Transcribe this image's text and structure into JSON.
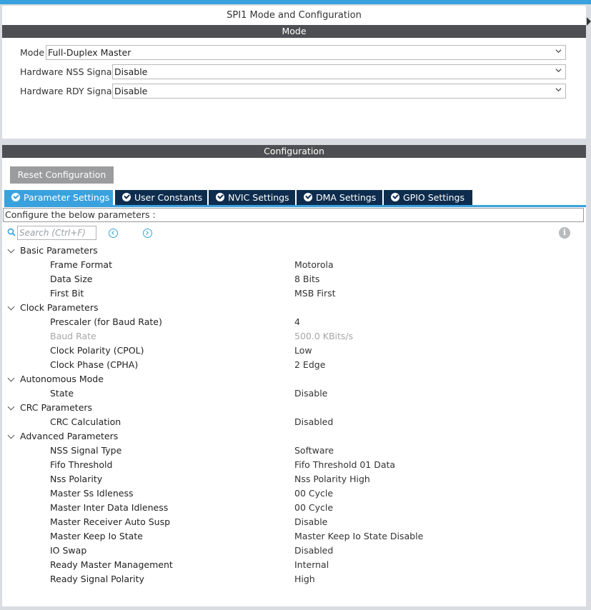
{
  "window": {
    "title": "SPI1 Mode and Configuration"
  },
  "mode_section": {
    "header": "Mode",
    "fields": [
      {
        "label": "Mode",
        "value": "Full-Duplex Master"
      },
      {
        "label": "Hardware NSS Signal",
        "value": "Disable"
      },
      {
        "label": "Hardware RDY Signal",
        "value": "Disable"
      }
    ]
  },
  "config_section": {
    "header": "Configuration",
    "reset_label": "Reset Configuration",
    "tabs": [
      {
        "label": "Parameter Settings",
        "active": true
      },
      {
        "label": "User Constants",
        "active": false
      },
      {
        "label": "NVIC Settings",
        "active": false
      },
      {
        "label": "DMA Settings",
        "active": false
      },
      {
        "label": "GPIO Settings",
        "active": false
      }
    ],
    "description": "Configure the below parameters :",
    "search": {
      "placeholder": "Search (Ctrl+F)"
    }
  },
  "params": {
    "groups": [
      {
        "name": "Basic Parameters",
        "items": [
          {
            "name": "Frame Format",
            "value": "Motorola"
          },
          {
            "name": "Data Size",
            "value": "8 Bits"
          },
          {
            "name": "First Bit",
            "value": "MSB First"
          }
        ]
      },
      {
        "name": "Clock Parameters",
        "items": [
          {
            "name": "Prescaler (for Baud Rate)",
            "value": "4"
          },
          {
            "name": "Baud Rate",
            "value": "500.0 KBits/s",
            "disabled": true
          },
          {
            "name": "Clock Polarity (CPOL)",
            "value": "Low"
          },
          {
            "name": "Clock Phase (CPHA)",
            "value": "2 Edge"
          }
        ]
      },
      {
        "name": "Autonomous Mode",
        "items": [
          {
            "name": "State",
            "value": "Disable"
          }
        ]
      },
      {
        "name": "CRC Parameters",
        "items": [
          {
            "name": "CRC Calculation",
            "value": "Disabled"
          }
        ]
      },
      {
        "name": "Advanced Parameters",
        "items": [
          {
            "name": "NSS Signal Type",
            "value": "Software"
          },
          {
            "name": "Fifo Threshold",
            "value": "Fifo Threshold 01 Data"
          },
          {
            "name": "Nss Polarity",
            "value": "Nss Polarity High"
          },
          {
            "name": "Master Ss Idleness",
            "value": "00 Cycle"
          },
          {
            "name": "Master Inter Data Idleness",
            "value": "00 Cycle"
          },
          {
            "name": "Master Receiver Auto Susp",
            "value": "Disable"
          },
          {
            "name": "Master Keep Io State",
            "value": "Master Keep Io State Disable"
          },
          {
            "name": "IO Swap",
            "value": "Disabled"
          },
          {
            "name": "Ready Master Management",
            "value": "Internal"
          },
          {
            "name": "Ready Signal Polarity",
            "value": "High"
          }
        ]
      }
    ]
  },
  "colors": {
    "accent": "#39a1dd",
    "tab_dark": "#0e2d4e",
    "header_bg": "#4d4f52"
  }
}
